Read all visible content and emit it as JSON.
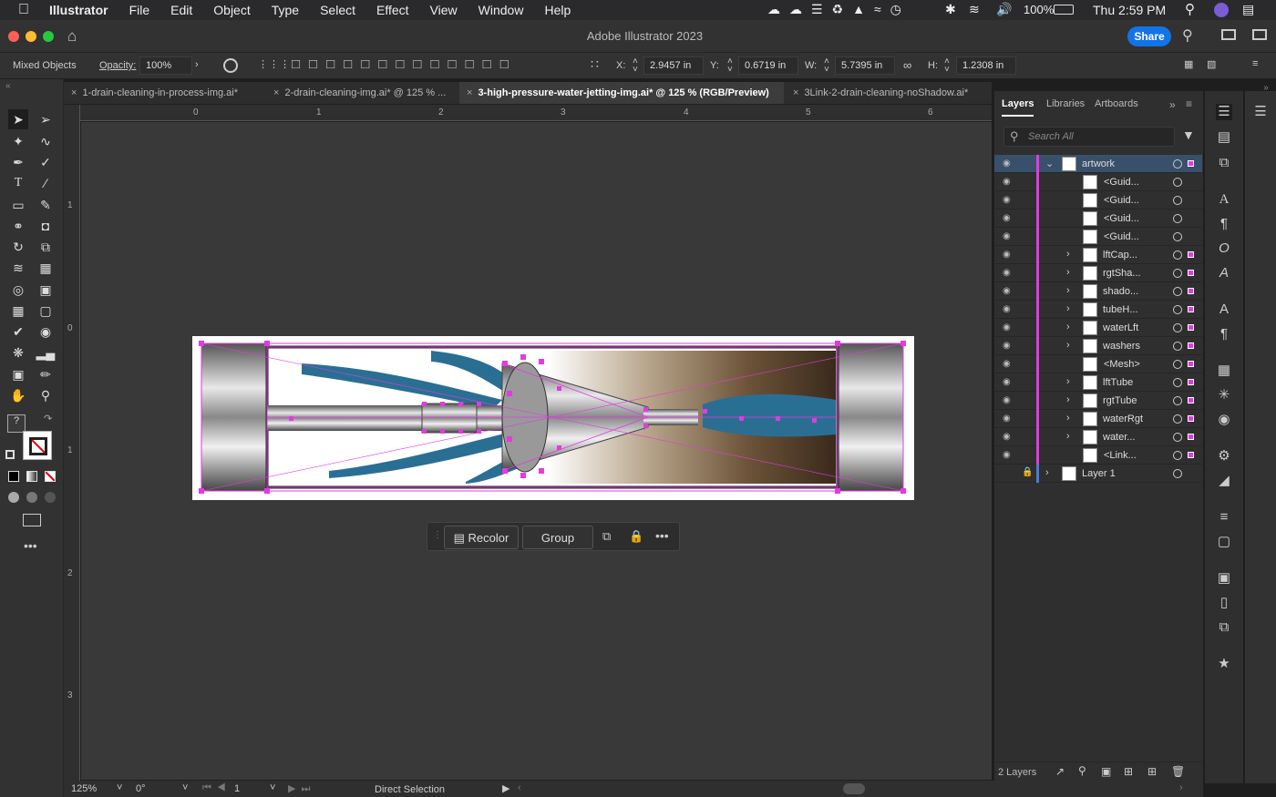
{
  "menubar": {
    "app": "Illustrator",
    "items": [
      "File",
      "Edit",
      "Object",
      "Type",
      "Select",
      "Effect",
      "View",
      "Window",
      "Help"
    ],
    "battery": "100%",
    "clock": "Thu 2:59 PM"
  },
  "window": {
    "title": "Adobe Illustrator 2023",
    "share_label": "Share"
  },
  "control": {
    "selection_label": "Mixed Objects",
    "opacity_label": "Opacity:",
    "opacity_value": "100%",
    "x_label": "X:",
    "x_value": "2.9457 in",
    "y_label": "Y:",
    "y_value": "0.6719 in",
    "w_label": "W:",
    "w_value": "5.7395 in",
    "h_label": "H:",
    "h_value": "1.2308 in"
  },
  "tabs": [
    {
      "label": "1-drain-cleaning-in-process-img.ai*"
    },
    {
      "label": "2-drain-cleaning-img.ai* @ 125 % ..."
    },
    {
      "label": "3-high-pressure-water-jetting-img.ai* @ 125 % (RGB/Preview)"
    },
    {
      "label": "3Link-2-drain-cleaning-noShadow.ai*"
    }
  ],
  "rulers": {
    "h": [
      "0",
      "1",
      "2",
      "3",
      "4",
      "5",
      "6"
    ],
    "v": [
      "1",
      "0",
      "1",
      "2",
      "3"
    ]
  },
  "context_bar": {
    "recolor_label": "Recolor",
    "group_label": "Group"
  },
  "panel": {
    "tabs": [
      "Layers",
      "Libraries",
      "Artboards"
    ],
    "search_placeholder": "Search All",
    "layers": [
      {
        "name": "artwork"
      },
      {
        "name": "<Guid..."
      },
      {
        "name": "<Guid..."
      },
      {
        "name": "<Guid..."
      },
      {
        "name": "<Guid..."
      },
      {
        "name": "lftCap..."
      },
      {
        "name": "rgtSha..."
      },
      {
        "name": "shado..."
      },
      {
        "name": "tubeH..."
      },
      {
        "name": "waterLft"
      },
      {
        "name": "washers"
      },
      {
        "name": "<Mesh>"
      },
      {
        "name": "lftTube"
      },
      {
        "name": "rgtTube"
      },
      {
        "name": "waterRgt"
      },
      {
        "name": "water..."
      },
      {
        "name": "<Link..."
      },
      {
        "name": "Layer 1"
      }
    ],
    "footer_count": "2 Layers"
  },
  "status": {
    "zoom": "125%",
    "rotation": "0°",
    "artboard": "1",
    "tool": "Direct Selection"
  },
  "colors": {
    "accent": "#1473e6",
    "layer_color": "#e13be1",
    "water": "#2a6f93"
  }
}
